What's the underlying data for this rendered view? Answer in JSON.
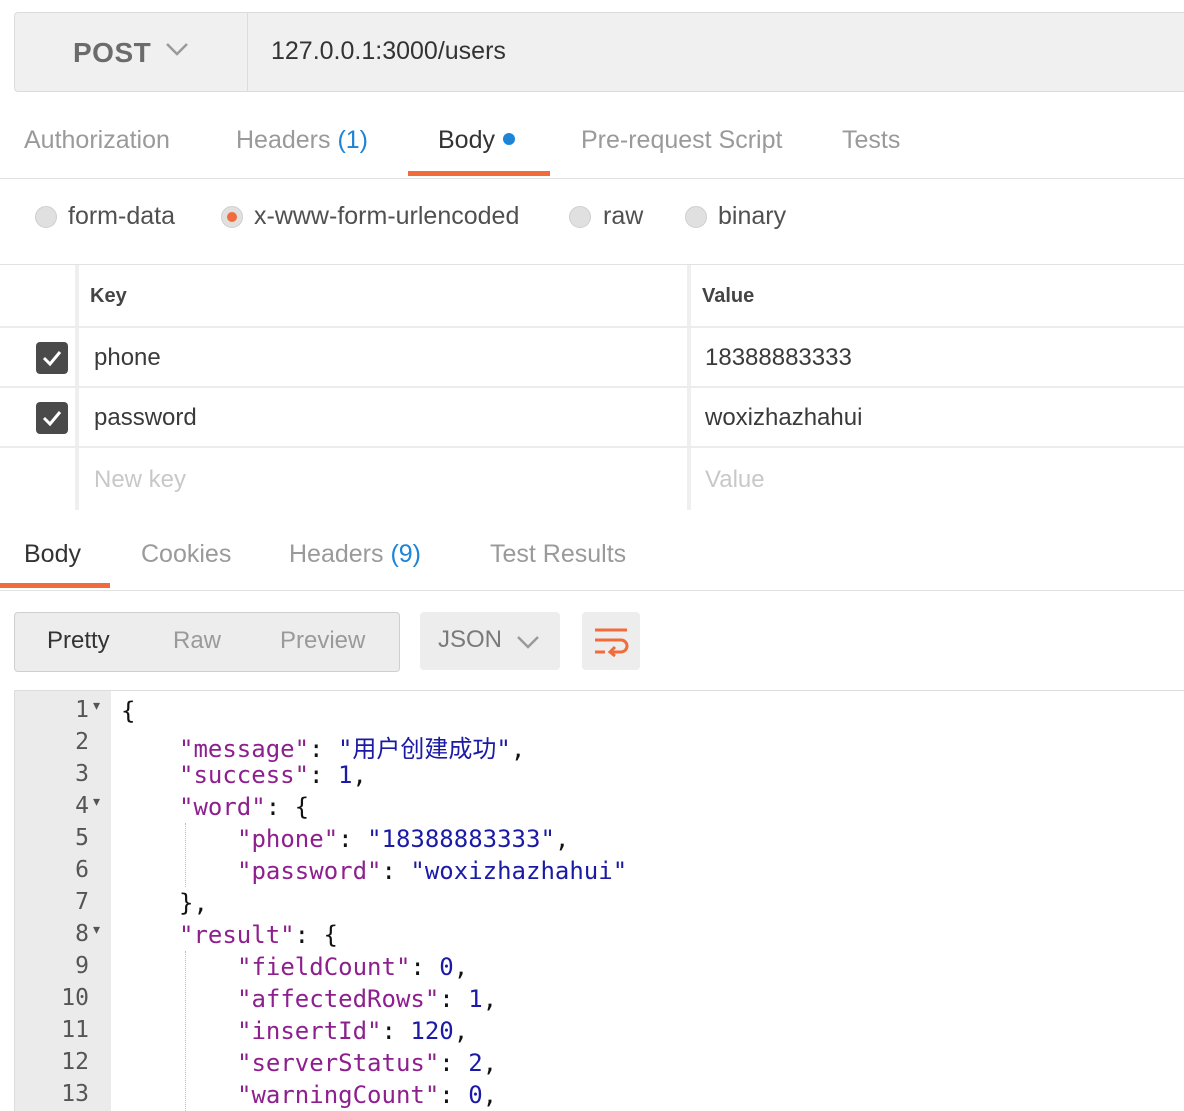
{
  "request": {
    "method": "POST",
    "url": "127.0.0.1:3000/users"
  },
  "request_tabs": [
    {
      "label": "Authorization",
      "count": ""
    },
    {
      "label": "Headers",
      "count": "(1)"
    },
    {
      "label": "Body",
      "count": ""
    },
    {
      "label": "Pre-request Script",
      "count": ""
    },
    {
      "label": "Tests",
      "count": ""
    }
  ],
  "body_modes": [
    {
      "label": "form-data",
      "selected": false
    },
    {
      "label": "x-www-form-urlencoded",
      "selected": true
    },
    {
      "label": "raw",
      "selected": false
    },
    {
      "label": "binary",
      "selected": false
    }
  ],
  "params": {
    "key_header": "Key",
    "value_header": "Value",
    "rows": [
      {
        "key": "phone",
        "value": "18388883333",
        "checked": true
      },
      {
        "key": "password",
        "value": "woxizhazhahui",
        "checked": true
      }
    ],
    "new_key_placeholder": "New key",
    "new_value_placeholder": "Value"
  },
  "response_tabs": [
    {
      "label": "Body",
      "count": ""
    },
    {
      "label": "Cookies",
      "count": ""
    },
    {
      "label": "Headers",
      "count": "(9)"
    },
    {
      "label": "Test Results",
      "count": ""
    }
  ],
  "view_modes": [
    "Pretty",
    "Raw",
    "Preview"
  ],
  "format": "JSON",
  "colors": {
    "accent": "#f26b3a",
    "link_blue": "#1d84d6",
    "json_key": "#8e1f8e",
    "json_value": "#1a1aa6"
  },
  "code_lines": [
    {
      "num": "1",
      "fold": true,
      "indent": 0,
      "parts": [
        {
          "t": "{",
          "c": "p"
        }
      ]
    },
    {
      "num": "2",
      "fold": false,
      "indent": 1,
      "parts": [
        {
          "t": "\"message\"",
          "c": "k"
        },
        {
          "t": ": ",
          "c": "p"
        },
        {
          "t": "\"用户创建成功\"",
          "c": "s"
        },
        {
          "t": ",",
          "c": "p"
        }
      ]
    },
    {
      "num": "3",
      "fold": false,
      "indent": 1,
      "parts": [
        {
          "t": "\"success\"",
          "c": "k"
        },
        {
          "t": ": ",
          "c": "p"
        },
        {
          "t": "1",
          "c": "n"
        },
        {
          "t": ",",
          "c": "p"
        }
      ]
    },
    {
      "num": "4",
      "fold": true,
      "indent": 1,
      "parts": [
        {
          "t": "\"word\"",
          "c": "k"
        },
        {
          "t": ": {",
          "c": "p"
        }
      ]
    },
    {
      "num": "5",
      "fold": false,
      "indent": 2,
      "parts": [
        {
          "t": "\"phone\"",
          "c": "k"
        },
        {
          "t": ": ",
          "c": "p"
        },
        {
          "t": "\"18388883333\"",
          "c": "s"
        },
        {
          "t": ",",
          "c": "p"
        }
      ]
    },
    {
      "num": "6",
      "fold": false,
      "indent": 2,
      "parts": [
        {
          "t": "\"password\"",
          "c": "k"
        },
        {
          "t": ": ",
          "c": "p"
        },
        {
          "t": "\"woxizhazhahui\"",
          "c": "s"
        }
      ]
    },
    {
      "num": "7",
      "fold": false,
      "indent": 1,
      "parts": [
        {
          "t": "},",
          "c": "p"
        }
      ]
    },
    {
      "num": "8",
      "fold": true,
      "indent": 1,
      "parts": [
        {
          "t": "\"result\"",
          "c": "k"
        },
        {
          "t": ": {",
          "c": "p"
        }
      ]
    },
    {
      "num": "9",
      "fold": false,
      "indent": 2,
      "parts": [
        {
          "t": "\"fieldCount\"",
          "c": "k"
        },
        {
          "t": ": ",
          "c": "p"
        },
        {
          "t": "0",
          "c": "n"
        },
        {
          "t": ",",
          "c": "p"
        }
      ]
    },
    {
      "num": "10",
      "fold": false,
      "indent": 2,
      "parts": [
        {
          "t": "\"affectedRows\"",
          "c": "k"
        },
        {
          "t": ": ",
          "c": "p"
        },
        {
          "t": "1",
          "c": "n"
        },
        {
          "t": ",",
          "c": "p"
        }
      ]
    },
    {
      "num": "11",
      "fold": false,
      "indent": 2,
      "parts": [
        {
          "t": "\"insertId\"",
          "c": "k"
        },
        {
          "t": ": ",
          "c": "p"
        },
        {
          "t": "120",
          "c": "n"
        },
        {
          "t": ",",
          "c": "p"
        }
      ]
    },
    {
      "num": "12",
      "fold": false,
      "indent": 2,
      "parts": [
        {
          "t": "\"serverStatus\"",
          "c": "k"
        },
        {
          "t": ": ",
          "c": "p"
        },
        {
          "t": "2",
          "c": "n"
        },
        {
          "t": ",",
          "c": "p"
        }
      ]
    },
    {
      "num": "13",
      "fold": false,
      "indent": 2,
      "parts": [
        {
          "t": "\"warningCount\"",
          "c": "k"
        },
        {
          "t": ": ",
          "c": "p"
        },
        {
          "t": "0",
          "c": "n"
        },
        {
          "t": ",",
          "c": "p"
        }
      ]
    }
  ]
}
